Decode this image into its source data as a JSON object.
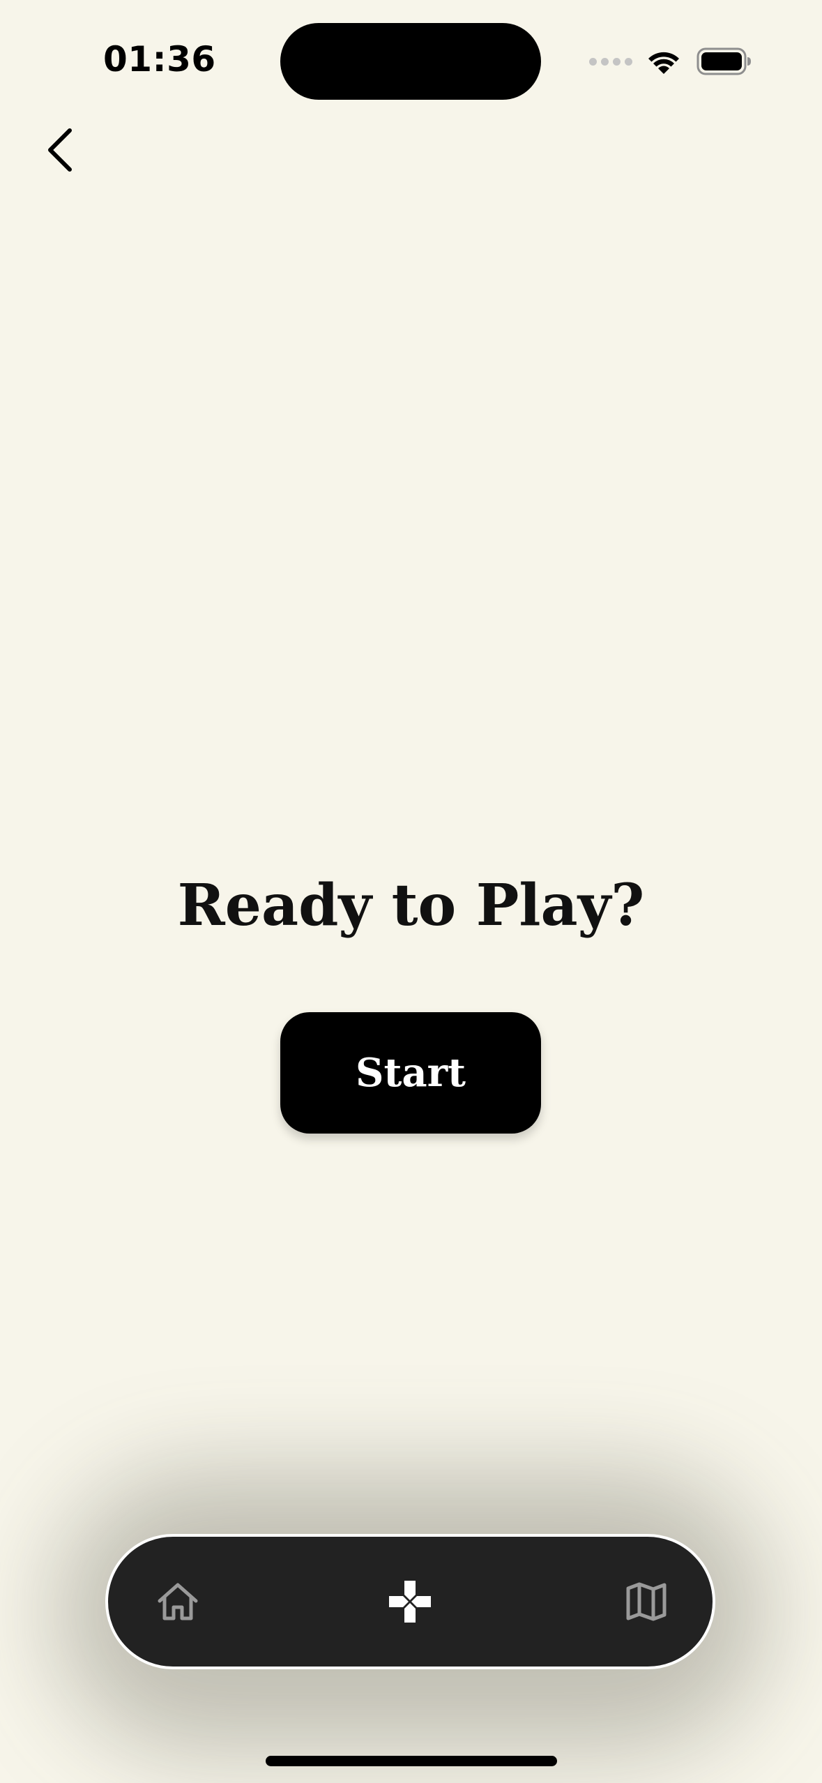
{
  "status_bar": {
    "time": "01:36"
  },
  "navigation": {
    "back_icon": "chevron-left-icon"
  },
  "main": {
    "title": "Ready to Play?",
    "start_label": "Start"
  },
  "tab_bar": {
    "items": [
      {
        "icon": "home-icon",
        "active": false
      },
      {
        "icon": "gamepad-icon",
        "active": true
      },
      {
        "icon": "map-icon",
        "active": false
      }
    ]
  },
  "colors": {
    "background": "#F7F5EA",
    "tab_bar": "#222222",
    "tab_inactive": "#9A9A9A",
    "tab_active": "#FFFFFF",
    "button": "#000000"
  }
}
